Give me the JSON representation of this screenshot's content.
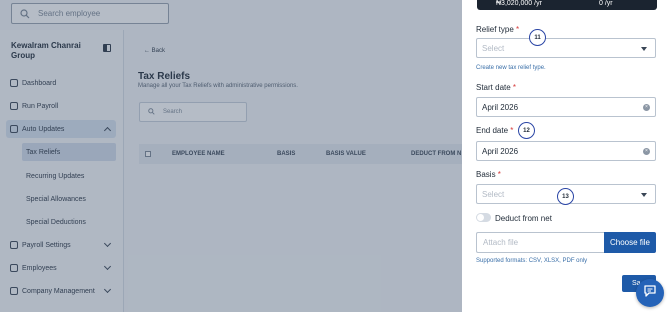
{
  "topbar": {
    "search_placeholder": "Search employee"
  },
  "sidebar": {
    "company": "Kewalram Chanrai Group",
    "items": [
      {
        "label": "Dashboard"
      },
      {
        "label": "Run Payroll"
      },
      {
        "label": "Auto Updates"
      },
      {
        "label": "Payroll Settings"
      },
      {
        "label": "Employees"
      },
      {
        "label": "Company Management"
      }
    ],
    "sub_items": [
      {
        "label": "Tax Reliefs"
      },
      {
        "label": "Recurring Updates"
      },
      {
        "label": "Special Allowances"
      },
      {
        "label": "Special Deductions"
      }
    ]
  },
  "main": {
    "back_label": "Back",
    "title": "Tax Reliefs",
    "subtitle": "Manage all your Tax Reliefs with administrative permissions.",
    "search_placeholder": "Search",
    "columns": [
      "EMPLOYEE NAME",
      "BASIS",
      "BASIS VALUE",
      "DEDUCT FROM N"
    ]
  },
  "drawer": {
    "banner_left": "₦3,020,000 /yr",
    "banner_right": "0 /yr",
    "relief_type": {
      "label": "Relief type",
      "required": "*",
      "placeholder": "Select"
    },
    "create_link": "Create new tax relief type.",
    "start_date": {
      "label": "Start date",
      "required": "*",
      "value": "April 2026"
    },
    "end_date": {
      "label": "End date",
      "required": "*",
      "value": "April 2026"
    },
    "basis": {
      "label": "Basis",
      "required": "*",
      "placeholder": "Select"
    },
    "deduct_label": "Deduct from net",
    "attach_placeholder": "Attach file",
    "choose_file": "Choose file",
    "formats": "Supported formats: CSV, XLSX, PDF only",
    "save_label": "Sa"
  },
  "annotations": {
    "badge_11": "11",
    "badge_12": "12",
    "badge_13": "13"
  },
  "colors": {
    "primary": "#1e5aa8",
    "required": "#d63a3a",
    "badge_ring": "#2a45a5"
  }
}
